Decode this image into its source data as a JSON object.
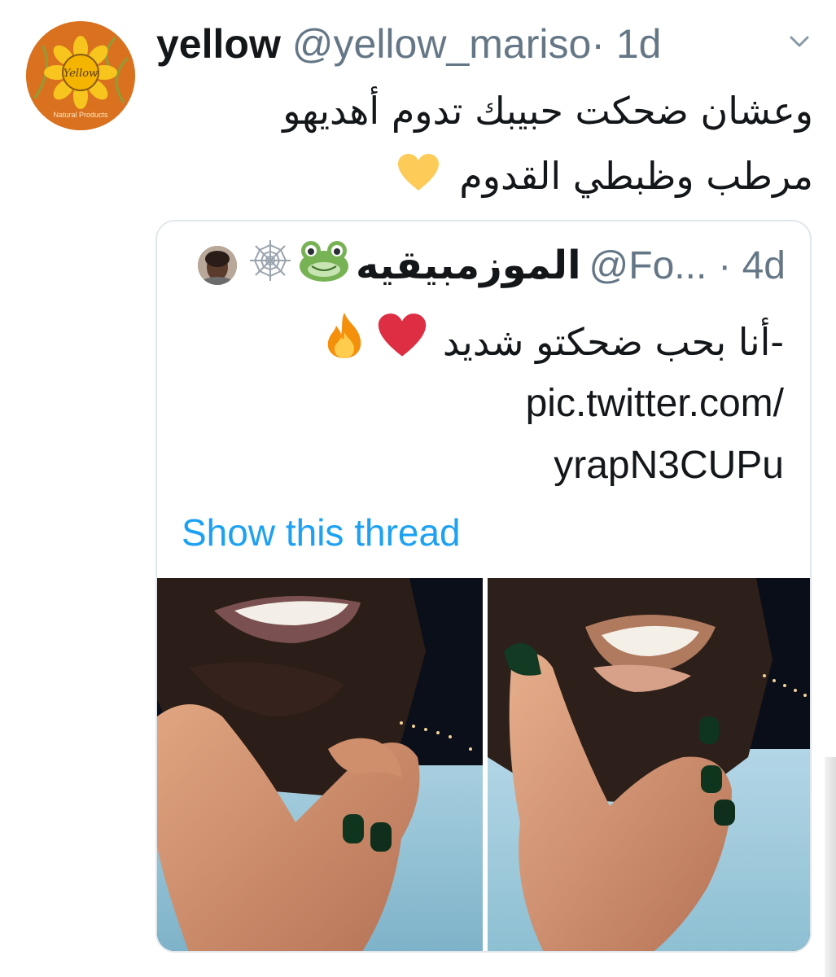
{
  "tweet": {
    "author_name": "yellow",
    "author_handle": "@yellow_mariso",
    "separator": "·",
    "time": "1d",
    "avatar_text_brand": "Yellow",
    "avatar_text_sub": "Natural Products",
    "text_line1": "وعشان ضحكت حبيبك تدوم أهديهو",
    "text_line2": "مرطب وظبطي القدوم",
    "end_emoji": "yellow-heart-icon"
  },
  "quoted": {
    "name": "الموزمبيقيه",
    "name_emojis": [
      "frog-face-icon",
      "spider-web-icon"
    ],
    "handle": "@Fo...",
    "separator": "·",
    "time": "4d",
    "text": "-أنا بحب ضحكتو شديد",
    "text_emojis": [
      "red-heart-icon",
      "fire-icon"
    ],
    "link_line1": "pic.twitter.com/",
    "link_line2": "yrapN3CUPu",
    "show_thread": "Show this thread",
    "media_count": 2
  },
  "colors": {
    "link_blue": "#1da1f2",
    "secondary_text": "#657786",
    "border": "#e1e8ed"
  }
}
